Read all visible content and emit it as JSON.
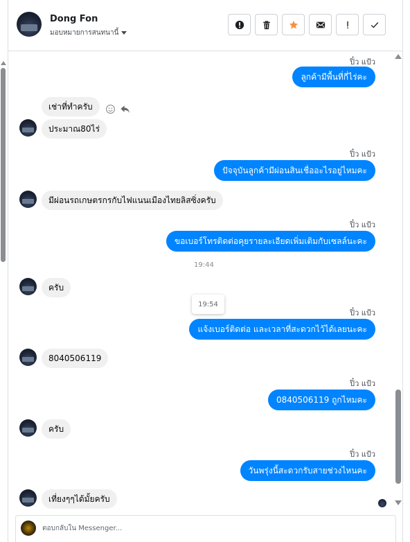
{
  "contact": {
    "name": "Dong Fon",
    "assign_label": "มอบหมายการสนทนานี้"
  },
  "toolbar": {
    "icons": [
      "alert-circle-icon",
      "trash-icon",
      "star-icon",
      "envelope-icon",
      "exclamation-icon",
      "check-icon"
    ],
    "star_color": "#f7923b"
  },
  "messages": {
    "m1": {
      "sender": "ปิ๋ว แป้ว",
      "text": "ลูกค้ามีพื้นที่กี่ไร่คะ"
    },
    "m2": {
      "text": "เช่าที่ทำครับ"
    },
    "m3": {
      "text": "ประมาณ80ไร่"
    },
    "m4": {
      "sender": "ปิ๋ว แป้ว",
      "text": "ปัจจุบันลูกค้ามีผ่อนสินเชื่ออะไรอยู่ไหมคะ"
    },
    "m5": {
      "text": "มีผ่อนรถเกษตรกรกับไฟแนนเมืองไทยลิสซิ่งครับ"
    },
    "m6": {
      "sender": "ปิ๋ว แป้ว",
      "text": "ขอเบอร์โทรติดต่อคุยรายละเอียดเพิ่มเติมกับเซลล์นะคะ"
    },
    "time1": "19:44",
    "m7": {
      "text": "ครับ"
    },
    "time_tooltip": "19:54",
    "m8": {
      "sender": "ปิ๋ว แป้ว",
      "text": "แจ้งเบอร์ติดต่อ  และเวลาที่สะดวกไว้ได้เลยนะคะ"
    },
    "m9": {
      "text": "8040506119"
    },
    "m10": {
      "sender": "ปิ๋ว แป้ว",
      "text": "0840506119  ถูกไหมคะ"
    },
    "m11": {
      "text": "ครับ"
    },
    "m12": {
      "sender": "ปิ๋ว แป้ว",
      "text": "วันพรุ่งนี้สะดวกรับสายช่วงไหนคะ"
    },
    "m13": {
      "text": "เที่ยงๆๆได้มั้ยครับ"
    }
  },
  "composer": {
    "placeholder": "ตอบกลับใน Messenger..."
  },
  "colors": {
    "outgoing_bubble": "#0084ff",
    "incoming_bubble": "#f0f0f0"
  }
}
